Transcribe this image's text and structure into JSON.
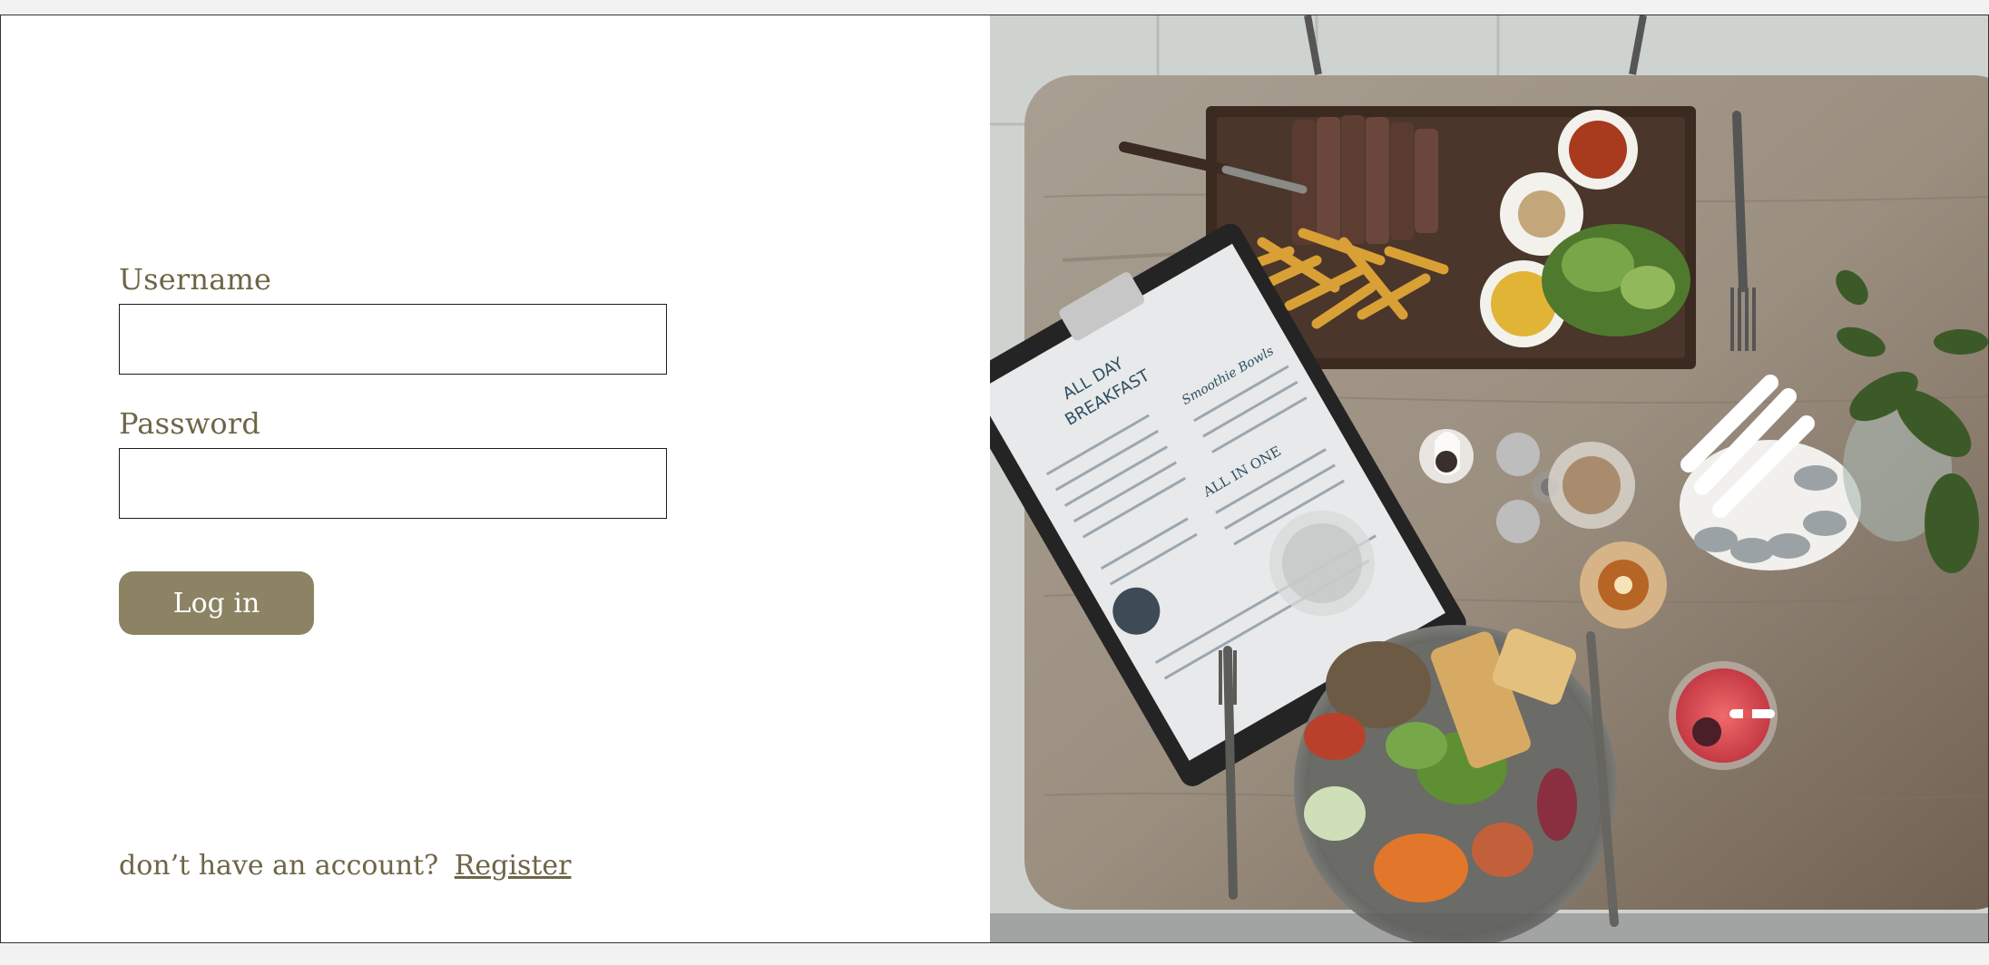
{
  "login_form": {
    "username_label": "Username",
    "username_value": "",
    "password_label": "Password",
    "password_value": "",
    "submit_label": "Log in"
  },
  "register": {
    "prompt": "don’t have an account?",
    "link_label": "Register"
  },
  "photo": {
    "description": "restaurant-table-food-photo",
    "menu_title_line1": "ALL DAY",
    "menu_title_line2": "BREAKFAST",
    "menu_section_1": "Smoothie Bowls",
    "menu_section_2": "ALL IN ONE"
  },
  "colors": {
    "accent": "#8b8363",
    "text": "#6e6548",
    "border": "#1c1c1c"
  }
}
